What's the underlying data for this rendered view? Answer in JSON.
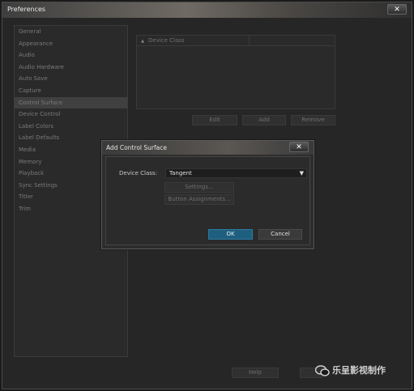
{
  "window": {
    "title": "Preferences",
    "close_glyph": "✕"
  },
  "sidebar": {
    "items": [
      {
        "label": "General"
      },
      {
        "label": "Appearance"
      },
      {
        "label": "Audio"
      },
      {
        "label": "Audio Hardware"
      },
      {
        "label": "Auto Save"
      },
      {
        "label": "Capture"
      },
      {
        "label": "Control Surface",
        "selected": true
      },
      {
        "label": "Device Control"
      },
      {
        "label": "Label Colors"
      },
      {
        "label": "Label Defaults"
      },
      {
        "label": "Media"
      },
      {
        "label": "Memory"
      },
      {
        "label": "Playback"
      },
      {
        "label": "Sync Settings"
      },
      {
        "label": "Titler"
      },
      {
        "label": "Trim"
      }
    ]
  },
  "control_surface": {
    "column_header": "Device Class",
    "edit_label": "Edit",
    "add_label": "Add",
    "remove_label": "Remove"
  },
  "footer": {
    "help_label": "Help"
  },
  "dialog": {
    "title": "Add Control Surface",
    "close_glyph": "✕",
    "device_class_label": "Device Class:",
    "device_class_value": "Tangent",
    "settings_label": "Settings...",
    "button_assignments_label": "Button Assignments...",
    "ok_label": "OK",
    "cancel_label": "Cancel"
  },
  "watermark": {
    "text": "乐呈影视制作"
  },
  "colors": {
    "ok_button": "#1f5f7e",
    "accent": "#3a7ca5"
  }
}
